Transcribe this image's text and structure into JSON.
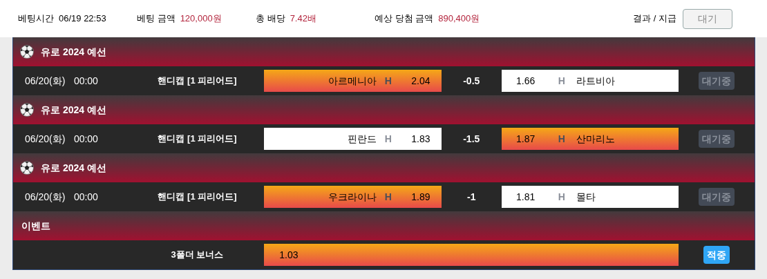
{
  "summary": [
    {
      "label": "베팅시간",
      "value": "06/19 22:53",
      "accent": false
    },
    {
      "label": "베팅 금액",
      "value": "120,000원",
      "accent": true
    },
    {
      "label": "총 배당",
      "value": "7.42배",
      "accent": true
    },
    {
      "label": "예상 당첨 금액",
      "value": "890,400원",
      "accent": true
    }
  ],
  "result": {
    "label": "결과 / 지급",
    "button": "대기"
  },
  "sections": [
    {
      "kind": "league",
      "title": "유로 2024 예선",
      "rows": [
        {
          "kind": "match",
          "date": "06/20(화)",
          "time": "00:00",
          "market": "핸디캡 [1 피리어드]",
          "home": {
            "team": "아르메니아",
            "mark": "H",
            "odds": "2.04",
            "selected": true
          },
          "line": "-0.5",
          "away": {
            "odds": "1.66",
            "mark": "H",
            "team": "라트비아",
            "selected": false
          },
          "status": {
            "label": "대기중",
            "kind": "pending"
          }
        }
      ]
    },
    {
      "kind": "league",
      "title": "유로 2024 예선",
      "rows": [
        {
          "kind": "match",
          "date": "06/20(화)",
          "time": "00:00",
          "market": "핸디캡 [1 피리어드]",
          "home": {
            "team": "핀란드",
            "mark": "H",
            "odds": "1.83",
            "selected": false
          },
          "line": "-1.5",
          "away": {
            "odds": "1.87",
            "mark": "H",
            "team": "산마리노",
            "selected": true
          },
          "status": {
            "label": "대기중",
            "kind": "pending"
          }
        }
      ]
    },
    {
      "kind": "league",
      "title": "유로 2024 예선",
      "rows": [
        {
          "kind": "match",
          "date": "06/20(화)",
          "time": "00:00",
          "market": "핸디캡 [1 피리어드]",
          "home": {
            "team": "우크라이나",
            "mark": "H",
            "odds": "1.89",
            "selected": true
          },
          "line": "-1",
          "away": {
            "odds": "1.81",
            "mark": "H",
            "team": "몰타",
            "selected": false
          },
          "status": {
            "label": "대기중",
            "kind": "pending"
          }
        }
      ]
    },
    {
      "kind": "event",
      "title": "이벤트",
      "rows": [
        {
          "kind": "bonus",
          "market": "3폴더 보너스",
          "odds": "1.03",
          "status": {
            "label": "적중",
            "kind": "win"
          }
        }
      ]
    }
  ]
}
